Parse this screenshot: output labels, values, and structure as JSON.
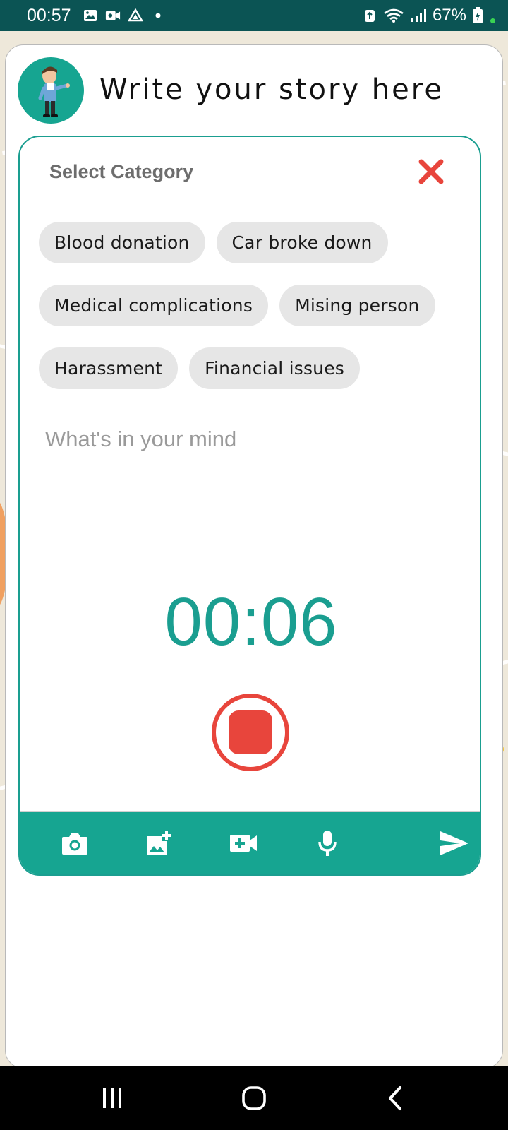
{
  "status_bar": {
    "time": "00:57",
    "battery": "67%"
  },
  "header": {
    "title": "Write your story here",
    "avatar_icon": "cartoon-man-avatar"
  },
  "compose": {
    "category_title": "Select Category",
    "categories": [
      [
        "Blood donation",
        "Car broke down"
      ],
      [
        "Medical complications",
        "Mising person"
      ],
      [
        "Harassment",
        "Financial issues"
      ]
    ],
    "story_placeholder": "What's in your mind",
    "timer": "00:06",
    "record_state": "recording"
  },
  "toolbar": {
    "icons": [
      "camera-icon",
      "add-photo-icon",
      "add-video-icon",
      "microphone-icon",
      "send-icon"
    ]
  },
  "colors": {
    "accent": "#16a591",
    "timer": "#1a9e90",
    "stop": "#e8453c",
    "close": "#e8453c",
    "chip_bg": "#e6e6e6",
    "status_bar": "#0b5454"
  }
}
